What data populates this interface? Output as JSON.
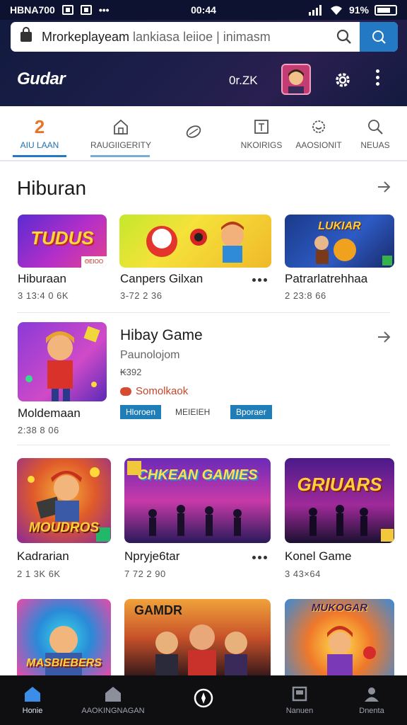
{
  "status_bar": {
    "carrier": "HBNA700",
    "time": "00:44",
    "battery": "91%"
  },
  "search": {
    "query": "Mrorkeplayeam",
    "query_muted": " lankiasa leiioe | inimasm"
  },
  "header": {
    "brand": "Gudar",
    "coins": "0r.ZK"
  },
  "tabs": [
    {
      "label": "AIU LAAN",
      "icon": "home-icon",
      "active": true
    },
    {
      "label": "RAUGIIGERITY",
      "icon": "house-icon",
      "active": false
    },
    {
      "label": "",
      "icon": "leaf-icon",
      "active": false
    },
    {
      "label": "NKOIRIGS",
      "icon": "grid-icon",
      "active": false
    },
    {
      "label": "AAOSIONIT",
      "icon": "badge-icon",
      "active": false
    },
    {
      "label": "NEUAS",
      "icon": "search-icon",
      "active": false
    }
  ],
  "section": {
    "title": "Hiburan"
  },
  "row1": [
    {
      "title": "Hiburaan",
      "sub": "3 13:4 0 6K",
      "img_label": "TUDUS",
      "badge": "ΘΕΙΟΟ"
    },
    {
      "title": "Canpers Gilxan",
      "sub": "3-72 2 36",
      "img_label": ""
    },
    {
      "title": "Patrarlatrehhaa",
      "sub": "2 23:8 66",
      "img_label": "LUKIAR"
    }
  ],
  "feature": {
    "caption": "Moldemaan",
    "caption_sub": "2:38 8 06",
    "title": "Hibay Game",
    "sub": "Paunolojom",
    "count": "₭392",
    "developer": "Somolkaok",
    "tags": [
      "Hloroen",
      "MEIEIEH",
      "Bporaer"
    ]
  },
  "row2": [
    {
      "title": "Kadrarian",
      "sub": "2 1 3K 6K",
      "img_label": "MOUDROS"
    },
    {
      "title": "Npryje6tar",
      "sub": "7 72 2 90",
      "img_label": "CHKEAN GAMIES"
    },
    {
      "title": "Konel Game",
      "sub": "3 43×64",
      "img_label": "GRIUARS"
    }
  ],
  "row3": [
    {
      "img_label": "MASBIEBERS"
    },
    {
      "img_label": "GAMDR"
    },
    {
      "img_label": "MUKOGAR"
    }
  ],
  "bottom_nav": [
    {
      "label": "Honie",
      "icon": "home-icon",
      "active": true
    },
    {
      "label": "AAOKINGNAGAN",
      "icon": "store-icon",
      "active": false
    },
    {
      "label": "",
      "icon": "compass-icon",
      "active": true
    },
    {
      "label": "Nanuen",
      "icon": "library-icon",
      "active": false
    },
    {
      "label": "Dnenta",
      "icon": "profile-icon",
      "active": false
    }
  ]
}
